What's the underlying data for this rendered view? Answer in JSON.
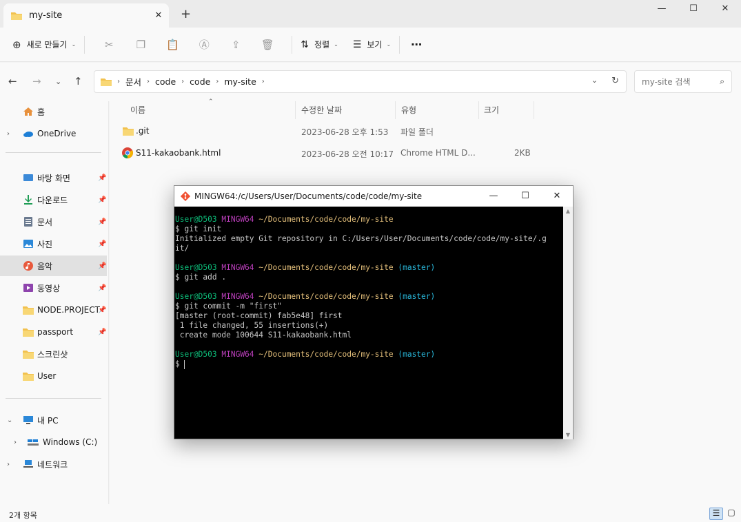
{
  "tab": {
    "title": "my-site",
    "close": "✕",
    "add": "+"
  },
  "window_controls": {
    "minimize": "—",
    "maximize": "☐",
    "close": "✕"
  },
  "toolbar": {
    "new_label": "새로 만들기",
    "sort_label": "정렬",
    "view_label": "보기",
    "more": "⋯"
  },
  "address": {
    "breadcrumbs": [
      "문서",
      "code",
      "code",
      "my-site"
    ],
    "search_placeholder": "my-site 검색"
  },
  "sidebar": {
    "home": "홈",
    "onedrive": "OneDrive",
    "quick": [
      {
        "label": "바탕 화면",
        "color": "#3c8ad8"
      },
      {
        "label": "다운로드",
        "color": "#1f9d55"
      },
      {
        "label": "문서",
        "color": "#6b7a8f"
      },
      {
        "label": "사진",
        "color": "#2b88d8"
      },
      {
        "label": "음악",
        "color": "#e8593c"
      },
      {
        "label": "동영상",
        "color": "#8e44ad"
      },
      {
        "label": "NODE.PROJECT",
        "color": "#f2c14e"
      },
      {
        "label": "passport",
        "color": "#f2c14e"
      },
      {
        "label": "스크린샷",
        "color": "#f2c14e"
      },
      {
        "label": "User",
        "color": "#f2c14e"
      }
    ],
    "this_pc": "내 PC",
    "drive": "Windows (C:)",
    "network": "네트워크"
  },
  "columns": {
    "name": "이름",
    "modified": "수정한 날짜",
    "type": "유형",
    "size": "크기"
  },
  "files": [
    {
      "name": ".git",
      "modified": "2023-06-28 오후 1:53",
      "type": "파일 폴더",
      "size": ""
    },
    {
      "name": "S11-kakaobank.html",
      "modified": "2023-06-28 오전 10:17",
      "type": "Chrome HTML D...",
      "size": "2KB"
    }
  ],
  "status": {
    "count": "2개 항목"
  },
  "terminal": {
    "title": "MINGW64:/c/Users/User/Documents/code/code/my-site",
    "user": "User@D503",
    "host": "MINGW64",
    "path": "~/Documents/code/code/my-site",
    "branch": "(master)",
    "cmd1": "$ git init",
    "out1a": "Initialized empty Git repository in C:/Users/User/Documents/code/code/my-site/.g",
    "out1b": "it/",
    "cmd2": "$ git add .",
    "cmd3": "$ git commit -m \"first\"",
    "out3a": "[master (root-commit) fab5e48] first",
    "out3b": " 1 file changed, 55 insertions(+)",
    "out3c": " create mode 100644 S11-kakaobank.html",
    "prompt": "$ "
  }
}
